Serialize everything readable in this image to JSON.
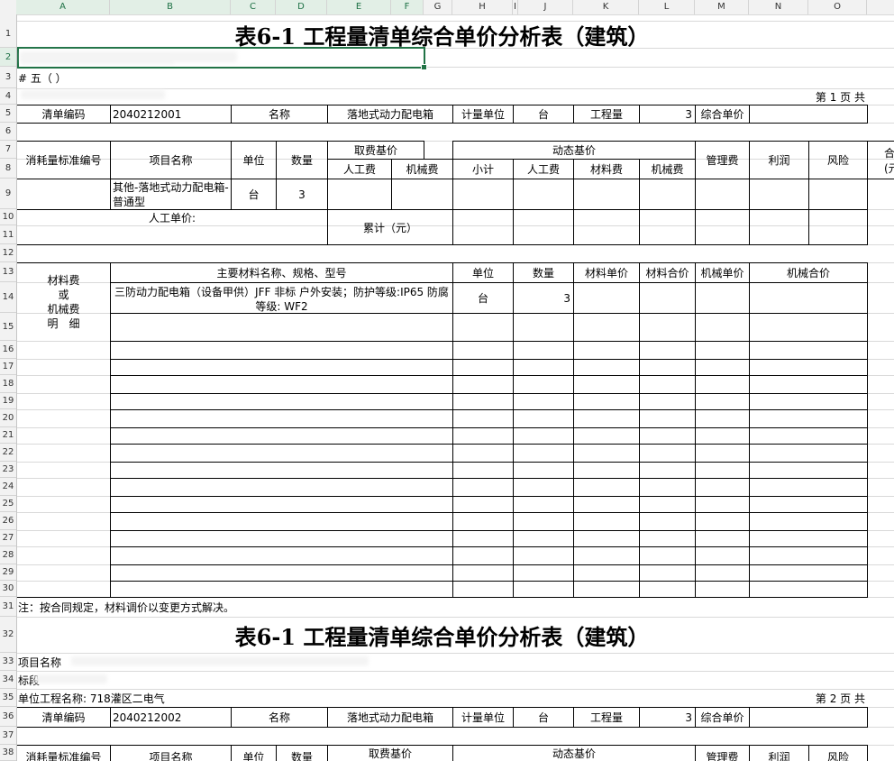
{
  "spreadsheet": {
    "columns": [
      "A",
      "B",
      "C",
      "D",
      "E",
      "F",
      "G",
      "H",
      "I",
      "J",
      "K",
      "L",
      "M",
      "N",
      "O"
    ],
    "rows": [
      "1",
      "2",
      "3",
      "4",
      "5",
      "6",
      "7",
      "8",
      "9",
      "10",
      "11",
      "12",
      "13",
      "14",
      "15",
      "16",
      "17",
      "18",
      "19",
      "20",
      "21",
      "22",
      "23",
      "24",
      "25",
      "26",
      "27",
      "28",
      "29",
      "30",
      "31",
      "32",
      "33",
      "34",
      "35",
      "36",
      "37",
      "38"
    ],
    "selection_color": "#217346"
  },
  "sheet1": {
    "title": "表6-1  工程量清单综合单价分析表（建筑）",
    "row3_text": "# 五（ ）",
    "page": "第 1 页  共",
    "item_code_label": "清单编码",
    "item_code": "2040212001",
    "name_label": "名称",
    "name_value": "落地式动力配电箱",
    "unit_label": "计量单位",
    "unit_value": "台",
    "qty_label": "工程量",
    "qty_value": "3",
    "unit_price_label": "综合单价",
    "std_code_label": "消耗量标准编号",
    "item_name_label": "项目名称",
    "unit_col": "单位",
    "qty_col": "数量",
    "base_price": "取费基价",
    "dyn_price": "动态基价",
    "labor": "人工费",
    "machine": "机械费",
    "subtotal": "小计",
    "material": "材料费",
    "mgmt": "管理费",
    "profit": "利润",
    "risk": "风险",
    "total_head": "合",
    "total_unit": "(元",
    "row9_name": "其他-落地式动力配电箱-普通型",
    "row9_unit": "台",
    "row9_qty": "3",
    "labor_unit_price": "人工单价:",
    "cumulative": "累计（元）",
    "mat_side": "材料费\n或\n机械费\n明　细",
    "mat_name_head": "主要材料名称、规格、型号",
    "mat_unit_head": "单位",
    "mat_qty_head": "数量",
    "mat_uprice": "材料单价",
    "mat_total": "材料合价",
    "mach_uprice": "机械单价",
    "mach_total": "机械合价",
    "mat_row_name": "三防动力配电箱（设备甲供）JFF 非标 户外安装；防护等级:IP65 防腐等级: WF2",
    "mat_row_unit": "台",
    "mat_row_qty": "3",
    "note": "注：按合同规定，材料调价以变更方式解决。"
  },
  "sheet2": {
    "title": "表6-1  工程量清单综合单价分析表（建筑）",
    "row33_text": "项目名称",
    "row34_text": "标段",
    "unit_project": "单位工程名称: 718灌区二电气",
    "page": "第 2 页  共",
    "item_code_label": "清单编码",
    "item_code": "2040212002",
    "name_label": "名称",
    "name_value": "落地式动力配电箱",
    "unit_label": "计量单位",
    "unit_value": "台",
    "qty_label": "工程量",
    "qty_value": "3",
    "unit_price_label": "综合单价",
    "std_code_label": "消耗量标准编号",
    "item_name_label": "项目名称",
    "unit_col": "单位",
    "qty_col": "数量",
    "base_price": "取费基价",
    "dyn_price": "动态基价",
    "mgmt": "管理费",
    "profit": "利润",
    "risk": "风险",
    "total_head": "合"
  }
}
